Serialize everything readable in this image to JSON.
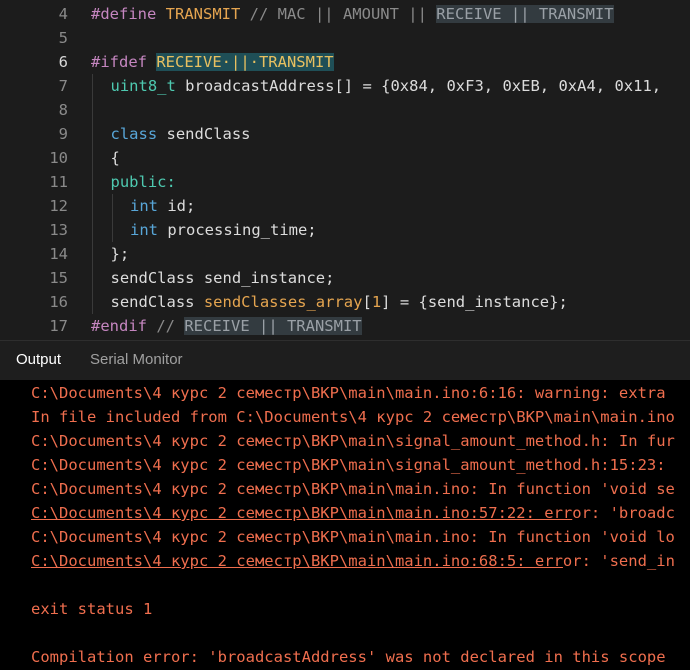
{
  "editor": {
    "lines": [
      {
        "num": "4",
        "parts": [
          {
            "t": "#define ",
            "c": "pp"
          },
          {
            "t": "TRANSMIT",
            "c": "macro"
          },
          {
            "t": " // MAC || AMOUNT || ",
            "c": "cm"
          },
          {
            "t": "RECEIVE || TRANSMIT",
            "c": "hl-dim"
          }
        ]
      },
      {
        "num": "5",
        "parts": []
      },
      {
        "num": "6",
        "active": true,
        "parts": [
          {
            "t": "#ifdef ",
            "c": "pp"
          },
          {
            "t": "RECEIVE·||·TRANSMIT",
            "c": "hl-sel"
          }
        ]
      },
      {
        "num": "7",
        "indent": 1,
        "parts": [
          {
            "t": "uint8_t",
            "c": "type"
          },
          {
            "t": " broadcastAddress[] = {",
            "c": ""
          },
          {
            "t": "0x84",
            "c": "hex"
          },
          {
            "t": ", ",
            "c": ""
          },
          {
            "t": "0xF3",
            "c": "hex"
          },
          {
            "t": ", ",
            "c": ""
          },
          {
            "t": "0xEB",
            "c": "hex"
          },
          {
            "t": ", ",
            "c": ""
          },
          {
            "t": "0xA4",
            "c": "hex"
          },
          {
            "t": ", ",
            "c": ""
          },
          {
            "t": "0x11",
            "c": "hex"
          },
          {
            "t": ", ",
            "c": ""
          }
        ]
      },
      {
        "num": "8",
        "parts": []
      },
      {
        "num": "9",
        "indent": 1,
        "parts": [
          {
            "t": "class",
            "c": "kwblue"
          },
          {
            "t": " sendClass",
            "c": ""
          }
        ]
      },
      {
        "num": "10",
        "indent": 1,
        "parts": [
          {
            "t": "{",
            "c": ""
          }
        ]
      },
      {
        "num": "11",
        "indent": 1,
        "parts": [
          {
            "t": "public:",
            "c": "kwteal"
          }
        ]
      },
      {
        "num": "12",
        "indent": 2,
        "parts": [
          {
            "t": "int",
            "c": "kwblue"
          },
          {
            "t": " id;",
            "c": ""
          }
        ]
      },
      {
        "num": "13",
        "indent": 2,
        "parts": [
          {
            "t": "int",
            "c": "kwblue"
          },
          {
            "t": " processing_time;",
            "c": ""
          }
        ]
      },
      {
        "num": "14",
        "indent": 1,
        "parts": [
          {
            "t": "};",
            "c": ""
          }
        ]
      },
      {
        "num": "15",
        "indent": 1,
        "parts": [
          {
            "t": "sendClass send_instance;",
            "c": ""
          }
        ]
      },
      {
        "num": "16",
        "indent": 1,
        "parts": [
          {
            "t": "sendClass ",
            "c": ""
          },
          {
            "t": "sendClasses_array",
            "c": "orange"
          },
          {
            "t": "[",
            "c": ""
          },
          {
            "t": "1",
            "c": "orange"
          },
          {
            "t": "] = {send_instance};",
            "c": ""
          }
        ]
      },
      {
        "num": "17",
        "parts": [
          {
            "t": "#endif",
            "c": "pp"
          },
          {
            "t": " // ",
            "c": "cm"
          },
          {
            "t": "RECEIVE || TRANSMIT",
            "c": "hl-dim"
          }
        ]
      }
    ]
  },
  "panel": {
    "tabs": [
      "Output",
      "Serial Monitor"
    ]
  },
  "output": {
    "lines": [
      {
        "t": "C:\\Documents\\4 курс 2 семестр\\ВКР\\main\\main.ino:6:16: warning: extra",
        "u": false
      },
      {
        "t": "In file included from C:\\Documents\\4 курс 2 семестр\\ВКР\\main\\main.ino",
        "u": false
      },
      {
        "t": "C:\\Documents\\4 курс 2 семестр\\ВКР\\main\\signal_amount_method.h: In fur",
        "u": false
      },
      {
        "t": "C:\\Documents\\4 курс 2 семестр\\ВКР\\main\\signal_amount_method.h:15:23:",
        "u": false
      },
      {
        "t": "C:\\Documents\\4 курс 2 семестр\\ВКР\\main\\main.ino: In function 'void se",
        "u": false
      },
      {
        "t": "C:\\Documents\\4 курс 2 семестр\\ВКР\\main\\main.ino:57:22: error: 'broadc",
        "u": true,
        "ulen": 58
      },
      {
        "t": "C:\\Documents\\4 курс 2 семестр\\ВКР\\main\\main.ino: In function 'void lo",
        "u": false
      },
      {
        "t": "C:\\Documents\\4 курс 2 семестр\\ВКР\\main\\main.ino:68:5: error: 'send_in",
        "u": true,
        "ulen": 57
      },
      {
        "t": "",
        "u": false
      },
      {
        "t": "exit status 1",
        "u": false
      },
      {
        "t": "",
        "u": false
      },
      {
        "t": "Compilation error: 'broadcastAddress' was not declared in this scope",
        "u": false
      }
    ]
  }
}
